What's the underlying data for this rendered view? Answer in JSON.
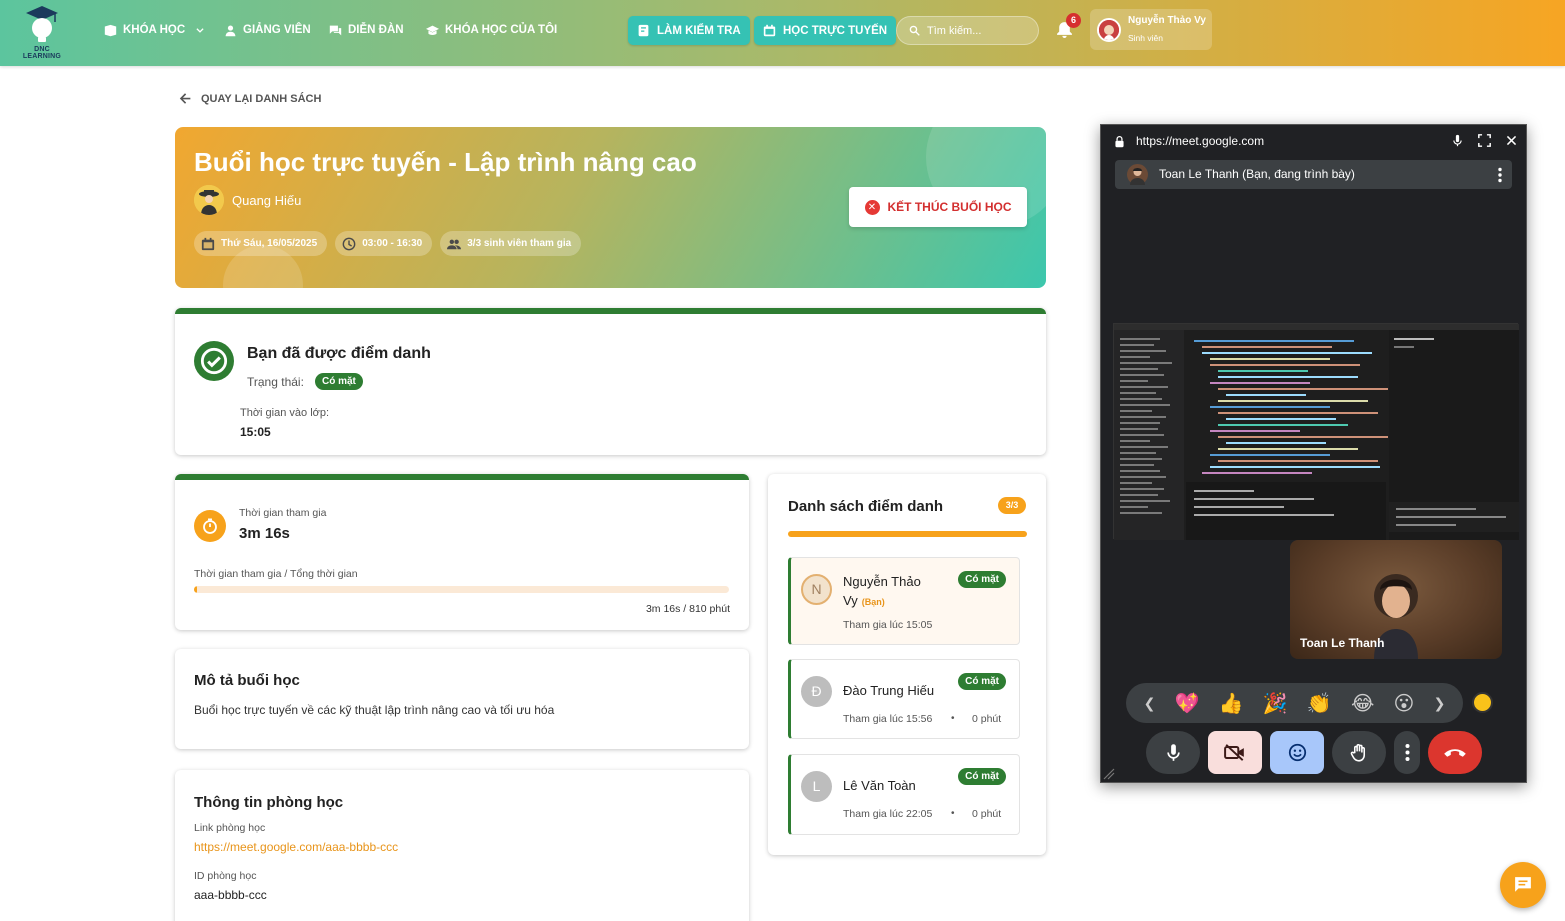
{
  "nav": {
    "logo_text": "DNC LEARNING",
    "items": [
      "KHÓA HỌC",
      "GIẢNG VIÊN",
      "DIỄN ĐÀN",
      "KHÓA HỌC CỦA TÔI"
    ],
    "test_btn": "LÀM KIỂM TRA",
    "online_btn": "HỌC TRỰC TUYẾN",
    "search_placeholder": "Tìm kiếm...",
    "notif_count": "6",
    "user_name": "Nguyễn Thảo Vy",
    "user_role": "Sinh viên"
  },
  "back_label": "QUAY LẠI DANH SÁCH",
  "hero": {
    "title": "Buổi học trực tuyến - Lập trình nâng cao",
    "teacher": "Quang Hiếu",
    "date": "Thứ Sáu, 16/05/2025",
    "time": "03:00 - 16:30",
    "participants": "3/3 sinh viên tham gia",
    "end_btn": "KẾT THÚC BUỔI HỌC"
  },
  "attendance": {
    "title": "Bạn đã được điểm danh",
    "status_label": "Trạng thái:",
    "status": "Có mặt",
    "time_label": "Thời gian vào lớp:",
    "time": "15:05"
  },
  "participation": {
    "label": "Thời gian tham gia",
    "value": "3m 16s",
    "progress_label": "Thời gian tham gia / Tổng thời gian",
    "progress_fraction": 0.004,
    "progress_text": "3m 16s / 810 phút"
  },
  "description": {
    "title": "Mô tả buổi học",
    "text": "Buổi học trực tuyến về các kỹ thuật lập trình nâng cao và tối ưu hóa"
  },
  "room": {
    "title": "Thông tin phòng học",
    "link_label": "Link phòng học",
    "link": "https://meet.google.com/aaa-bbbb-ccc",
    "id_label": "ID phòng học",
    "id": "aaa-bbbb-ccc"
  },
  "roster": {
    "title": "Danh sách điểm danh",
    "count": "3/3",
    "people": [
      {
        "initial": "N",
        "name": "Nguyễn Thảo Vy",
        "you": "(Bạn)",
        "status": "Có mặt",
        "joined": "Tham gia lúc 15:05",
        "duration": ""
      },
      {
        "initial": "Đ",
        "name": "Đào Trung Hiếu",
        "you": "",
        "status": "Có mặt",
        "joined": "Tham gia lúc 15:56",
        "duration": "0 phút"
      },
      {
        "initial": "L",
        "name": "Lê Văn Toàn",
        "you": "",
        "status": "Có mặt",
        "joined": "Tham gia lúc 22:05",
        "duration": "0 phút"
      }
    ]
  },
  "meet": {
    "url": "https://meet.google.com",
    "presenter": "Toan Le Thanh (Bạn, đang trình bày)",
    "self_name": "Toan Le Thanh",
    "reactions": [
      "💖",
      "👍",
      "🎉",
      "👏",
      "😂",
      "😮"
    ]
  },
  "colors": {
    "brand_orange": "#f7a21b",
    "present_green": "#2e7d32",
    "end_red": "#d32f2f"
  }
}
